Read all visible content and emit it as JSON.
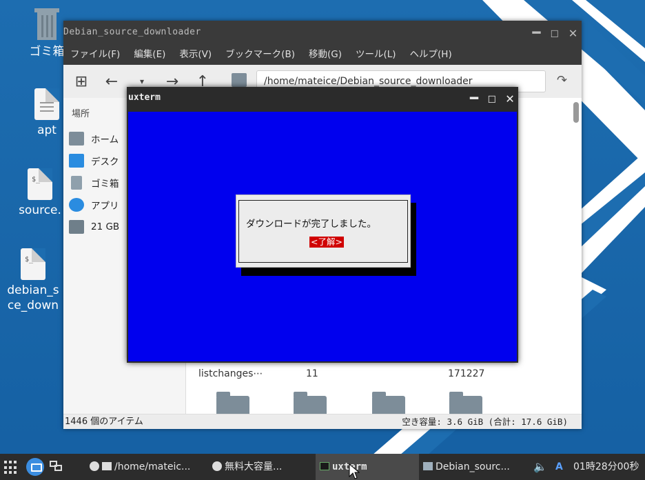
{
  "desktop": {
    "icons": [
      {
        "label": "ゴミ箱",
        "icon": "trash-icon"
      },
      {
        "label": "apt",
        "icon": "text-file-icon"
      },
      {
        "label": "source.",
        "icon": "script-file-icon"
      },
      {
        "label": "debian_s",
        "label2": "ce_down",
        "icon": "script-file-icon"
      }
    ]
  },
  "file_manager": {
    "title": "Debian_source_downloader",
    "menu": [
      "ファイル(F)",
      "編集(E)",
      "表示(V)",
      "ブックマーク(B)",
      "移動(G)",
      "ツール(L)",
      "ヘルプ(H)"
    ],
    "address": "/home/mateice/Debian_source_downloader",
    "sidebar_heading": "場所",
    "sidebar_items": [
      {
        "label": "ホーム",
        "icon": "home-folder-icon"
      },
      {
        "label": "デスク",
        "icon": "desktop-folder-icon"
      },
      {
        "label": "ゴミ箱",
        "icon": "trash-icon"
      },
      {
        "label": "アプリ",
        "icon": "download-icon"
      },
      {
        "label": "21 GB",
        "icon": "drive-icon"
      }
    ],
    "content_labels": [
      "listchanges⋯",
      "11",
      "171227"
    ],
    "status_left": "1446 個のアイテム",
    "status_right": "空き容量: 3.6 GiB (合計: 17.6 GiB)"
  },
  "terminal": {
    "title": "uxterm",
    "dialog_message": "ダウンロードが完了しました。",
    "dialog_button": "<了解>"
  },
  "taskbar": {
    "items": [
      "/home/mateic...",
      "無料大容量...",
      "uxterm",
      "Debian_sourc..."
    ],
    "input_indicator": "A",
    "clock": "01時28分00秒"
  }
}
